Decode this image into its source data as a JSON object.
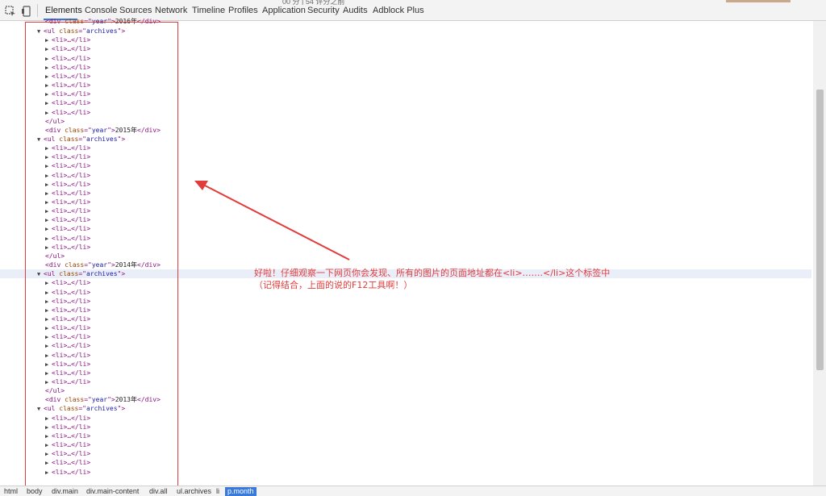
{
  "toolbar": {
    "tabs": [
      "Elements",
      "Console",
      "Sources",
      "Network",
      "Timeline",
      "Profiles",
      "Application",
      "Security",
      "Audits",
      "Adblock Plus"
    ],
    "active_tab": "Elements",
    "top_peek_text": "00 分 | 54 评分之前"
  },
  "dom": {
    "div_tag": "div",
    "class_attr": "class",
    "year_val": "year",
    "ul_tag": "ul",
    "archives_val": "archives",
    "li_collapsed": "<li>…</li>",
    "ul_close": "</ul>",
    "years": [
      "2016年",
      "2015年",
      "2014年",
      "2013年"
    ]
  },
  "annotation": {
    "line1": "好啦！仔细观察一下网页你会发现、所有的图片的页面地址都在<li>…….</li>这个标签中",
    "line2": "（记得结合，上面的说的F12工具啊！）"
  },
  "breadcrumbs": [
    "html",
    "body",
    "div.main",
    "div.main-content",
    "div.all",
    "ul.archives",
    "li",
    "p.month"
  ],
  "active_crumb": "p.month",
  "colors": {
    "annotation": "#e23b3b",
    "tag": "#881280",
    "attr": "#994500",
    "value": "#1a1aa6",
    "accent": "#3879d9"
  }
}
